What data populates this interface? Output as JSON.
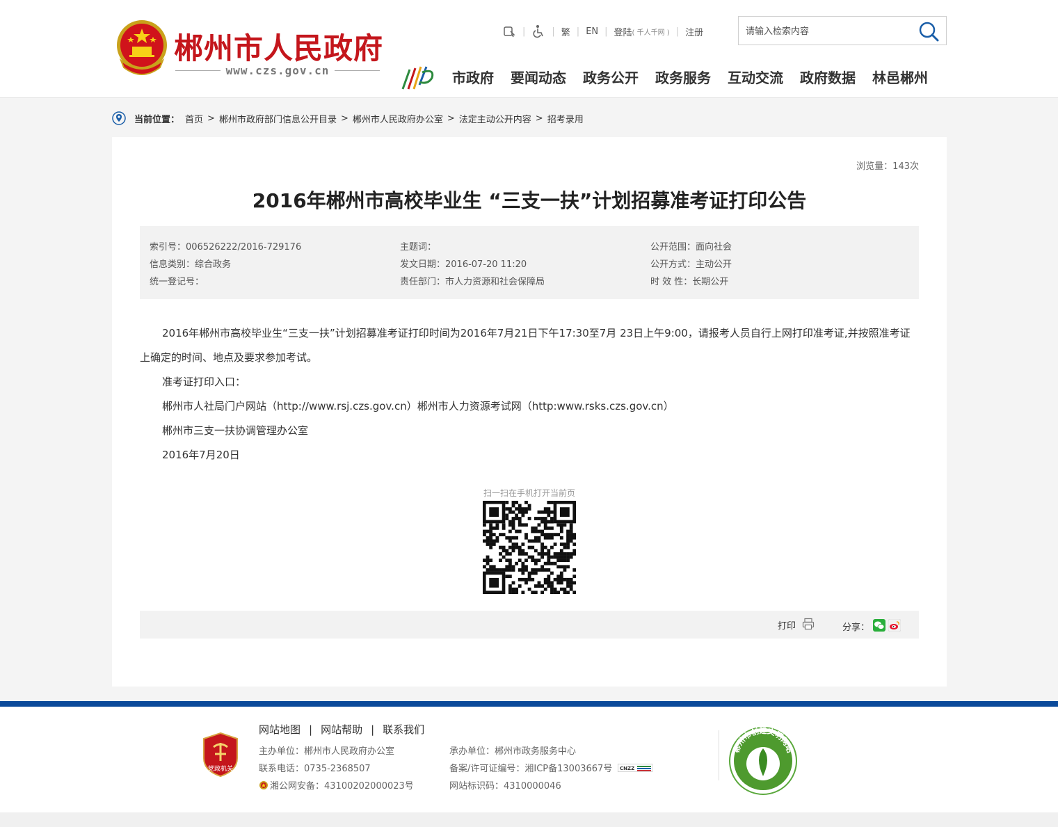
{
  "header": {
    "site_title": "郴州市人民政府",
    "site_domain": "www.czs.gov.cn",
    "util": {
      "traditional": "繁",
      "english": "EN",
      "login": "登陆",
      "login_note": "( 千人千网 )",
      "register": "注册"
    },
    "search": {
      "placeholder": "请输入检索内容"
    },
    "nav": [
      "市政府",
      "要闻动态",
      "政务公开",
      "政务服务",
      "互动交流",
      "政府数据",
      "林邑郴州"
    ]
  },
  "breadcrumb": {
    "label": "当前位置：",
    "items": [
      "首页",
      "郴州市政府部门信息公开目录",
      "郴州市人民政府办公室",
      "法定主动公开内容",
      "招考录用"
    ]
  },
  "article": {
    "views": "浏览量：143次",
    "title": "2016年郴州市高校毕业生 “三支一扶”计划招募准考证打印公告",
    "meta": {
      "col1": [
        "索引号：006526222/2016-729176",
        "信息类别：综合政务",
        "统一登记号："
      ],
      "col2": [
        "主题词：",
        "发文日期：2016-07-20 11:20",
        "责任部门：市人力资源和社会保障局"
      ],
      "col3": [
        "公开范围：面向社会",
        "公开方式：主动公开",
        "时 效 性：长期公开"
      ]
    },
    "paragraphs": [
      "2016年郴州市高校毕业生“三支一扶”计划招募准考证打印时间为2016年7月21日下午17:30至7月 23日上午9:00，请报考人员自行上网打印准考证,并按照准考证上确定的时间、地点及要求参加考试。",
      "准考证打印入口：",
      "郴州市人社局门户网站（http://www.rsj.czs.gov.cn）郴州市人力资源考试网（http:www.rsks.czs.gov.cn）",
      "郴州市三支一扶协调管理办公室",
      "2016年7月20日"
    ],
    "qr_caption": "扫一扫在手机打开当前页",
    "print_label": "打印",
    "share_label": "分享："
  },
  "footer": {
    "links": [
      "网站地图",
      "网站帮助",
      "联系我们"
    ],
    "left": [
      "主办单位：郴州市人民政府办公室",
      "联系电话：0735-2368507",
      "湘公网安备：43100202000023号"
    ],
    "right": [
      "承办单位：郴州市政务服务中心",
      "备案/许可证编号：湘ICP备13003667号",
      "网站标识码：4310000046"
    ],
    "badge_text": "党政机关",
    "civil_badge_text": "郴州市创建文明网站",
    "cnzz_text": "CNZZ"
  }
}
